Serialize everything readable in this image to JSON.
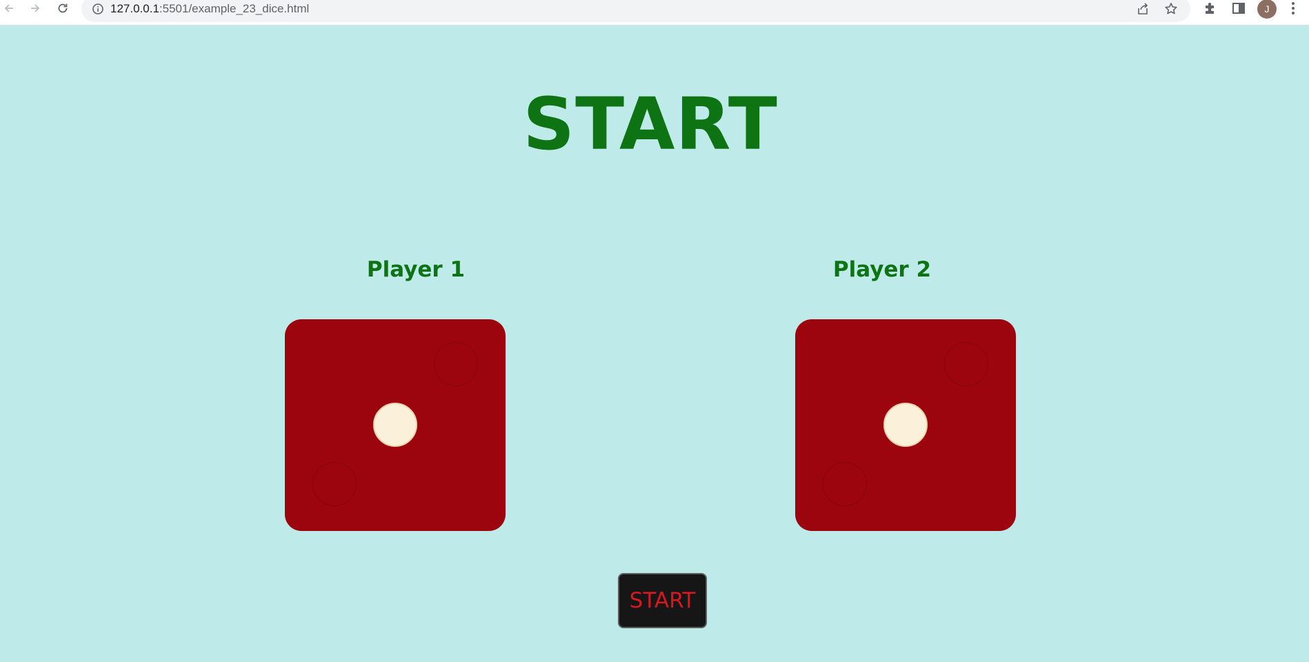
{
  "browser": {
    "url_host": "127.0.0.1",
    "url_path": ":5501/example_23_dice.html",
    "avatar_initial": "J",
    "icons": [
      "back-arrow-icon",
      "forward-arrow-icon",
      "reload-icon",
      "site-info-icon",
      "share-icon",
      "star-icon",
      "extensions-icon",
      "side-panel-icon",
      "more-menu-icon"
    ]
  },
  "page": {
    "title": "START",
    "background_color": "#bfeaea",
    "title_color": "#0d7313",
    "players": [
      {
        "label": "Player 1",
        "die_value": 1
      },
      {
        "label": "Player 2",
        "die_value": 1
      }
    ],
    "die_color": "#9c050e",
    "pip_color": "#fbf0d9",
    "start_button": {
      "label": "START",
      "text_color": "#d9171f",
      "background_color": "#161616"
    }
  }
}
